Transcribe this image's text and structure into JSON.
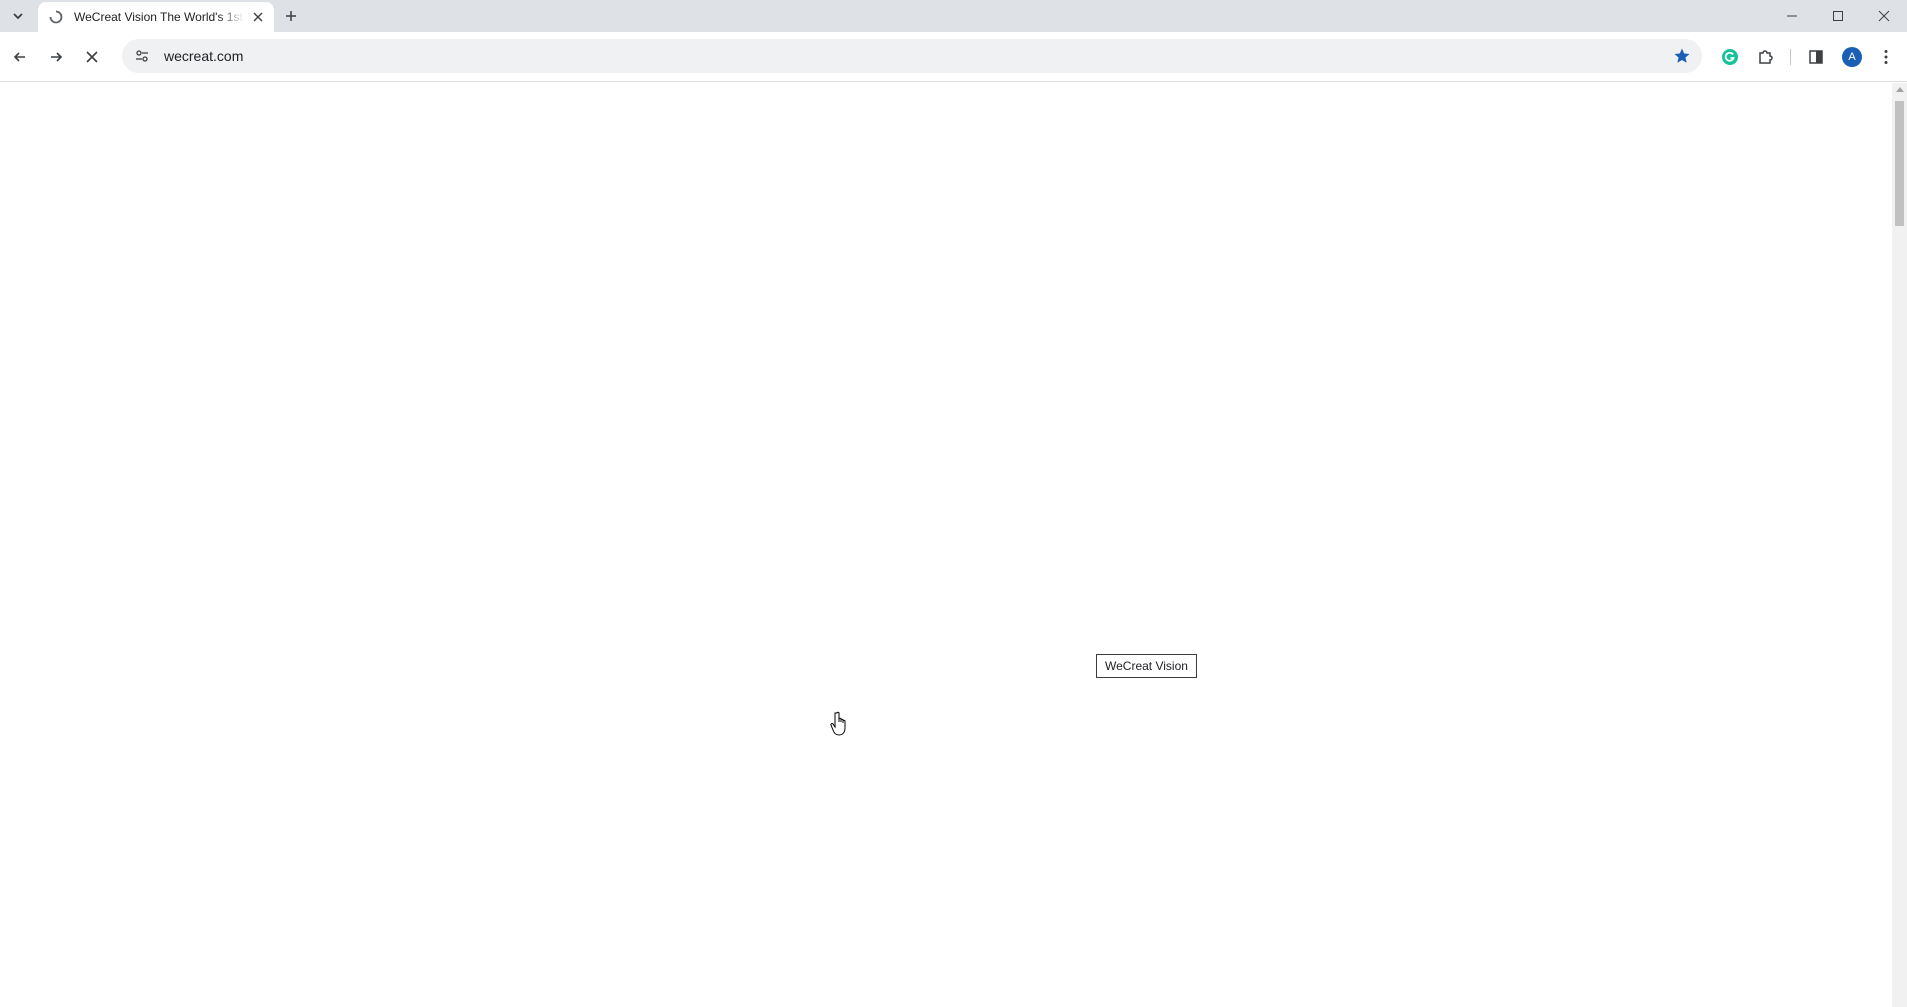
{
  "tab": {
    "title": "WeCreat Vision The World's 1st",
    "loading": true
  },
  "address_bar": {
    "url": "wecreat.com"
  },
  "page": {
    "tooltip": "WeCreat Vision"
  },
  "profile": {
    "initial": "A"
  },
  "icons": {
    "tab_search": "chevron-down-icon",
    "favicon": "loading-spinner-icon",
    "tab_close": "close-icon",
    "new_tab": "plus-icon",
    "minimize": "minimize-icon",
    "maximize": "maximize-icon",
    "close_window": "close-icon",
    "back": "arrow-left-icon",
    "forward": "arrow-right-icon",
    "stop": "stop-loading-icon",
    "site_info": "tune-icon",
    "bookmark": "star-filled-icon",
    "grammarly": "grammarly-icon",
    "extensions": "puzzle-icon",
    "side_panel": "side-panel-icon",
    "menu": "kebab-menu-icon"
  },
  "colors": {
    "tabstrip_bg": "#dee1e6",
    "omnibox_bg": "#eff1f3",
    "bookmark_star": "#1a5fb4",
    "grammarly": "#15c39a",
    "avatar": "#1a5fb4"
  }
}
